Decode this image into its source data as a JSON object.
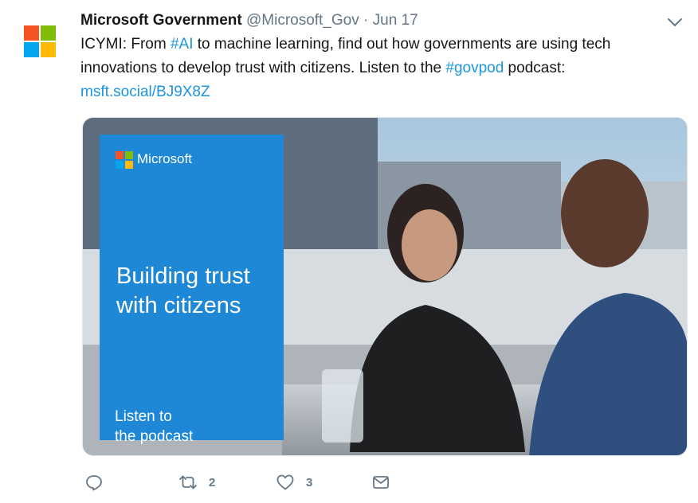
{
  "tweet": {
    "author_name": "Microsoft Government",
    "author_handle": "@Microsoft_Gov",
    "separator": "·",
    "date": "Jun 17",
    "text_intro": "ICYMI: From ",
    "hashtag_ai": "#AI",
    "text_mid": " to machine learning, find out how governments are using tech innovations to develop trust with citizens. Listen to the ",
    "hashtag_govpod": "#govpod",
    "text_end": " podcast:",
    "link": "msft.social/BJ9X8Z"
  },
  "media": {
    "brand_word": "Microsoft",
    "title": "Building trust with citizens",
    "subtitle_line1": "Listen to",
    "subtitle_line2": "the podcast"
  },
  "actions": {
    "reply_icon": "reply-icon",
    "retweet_icon": "retweet-icon",
    "retweet_count": "2",
    "like_icon": "heart-icon",
    "like_count": "3",
    "message_icon": "envelope-icon"
  },
  "colors": {
    "link": "#1b95e0",
    "muted": "#657786",
    "card_blue": "#1e88d6",
    "ms_red": "#f35325",
    "ms_green": "#81bc06",
    "ms_blue": "#05a6f0",
    "ms_yellow": "#ffba08"
  }
}
